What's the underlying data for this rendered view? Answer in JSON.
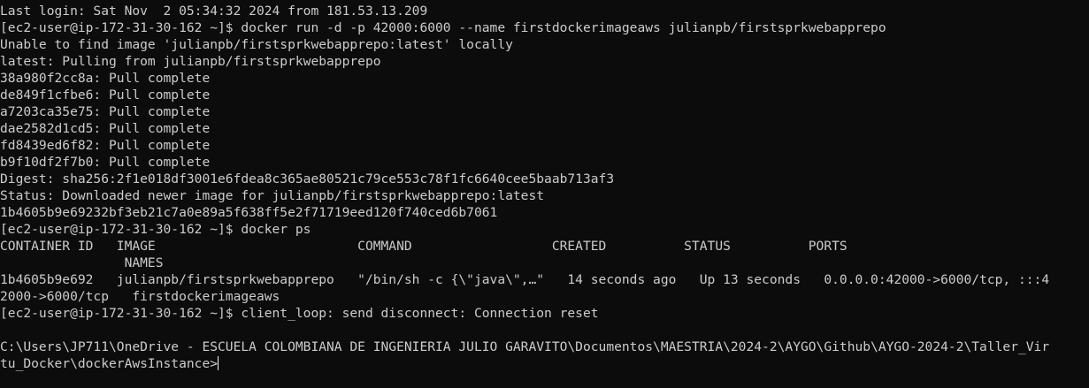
{
  "terminal": {
    "lines": [
      "Last login: Sat Nov  2 05:34:32 2024 from 181.53.13.209",
      "[ec2-user@ip-172-31-30-162 ~]$ docker run -d -p 42000:6000 --name firstdockerimageaws julianpb/firstsprkwebapprepo",
      "Unable to find image 'julianpb/firstsprkwebapprepo:latest' locally",
      "latest: Pulling from julianpb/firstsprkwebapprepo",
      "38a980f2cc8a: Pull complete",
      "de849f1cfbe6: Pull complete",
      "a7203ca35e75: Pull complete",
      "dae2582d1cd5: Pull complete",
      "fd8439ed6f82: Pull complete",
      "b9f10df2f7b0: Pull complete",
      "Digest: sha256:2f1e018df3001e6fdea8c365ae80521c79ce553c78f1fc6640cee5baab713af3",
      "Status: Downloaded newer image for julianpb/firstsprkwebapprepo:latest",
      "1b4605b9e69232bf3eb21c7a0e89a5f638ff5e2f71719eed120f740ced6b7061",
      "[ec2-user@ip-172-31-30-162 ~]$ docker ps",
      "CONTAINER ID   IMAGE                          COMMAND                  CREATED          STATUS          PORTS",
      "                NAMES",
      "1b4605b9e692   julianpb/firstsprkwebapprepo   \"/bin/sh -c {\\\"java\\\",…\"   14 seconds ago   Up 13 seconds   0.0.0.0:42000->6000/tcp, :::4",
      "2000->6000/tcp   firstdockerimageaws",
      "[ec2-user@ip-172-31-30-162 ~]$ client_loop: send disconnect: Connection reset",
      "",
      "C:\\Users\\JP711\\OneDrive - ESCUELA COLOMBIANA DE INGENIERIA JULIO GARAVITO\\Documentos\\MAESTRIA\\2024-2\\AYGO\\Github\\AYGO-2024-2\\Taller_Vir",
      "tu_Docker\\dockerAwsInstance>"
    ],
    "colors": {
      "background": "#0c0c0c",
      "foreground": "#cccccc",
      "cursor": "#f2f2f2"
    }
  }
}
